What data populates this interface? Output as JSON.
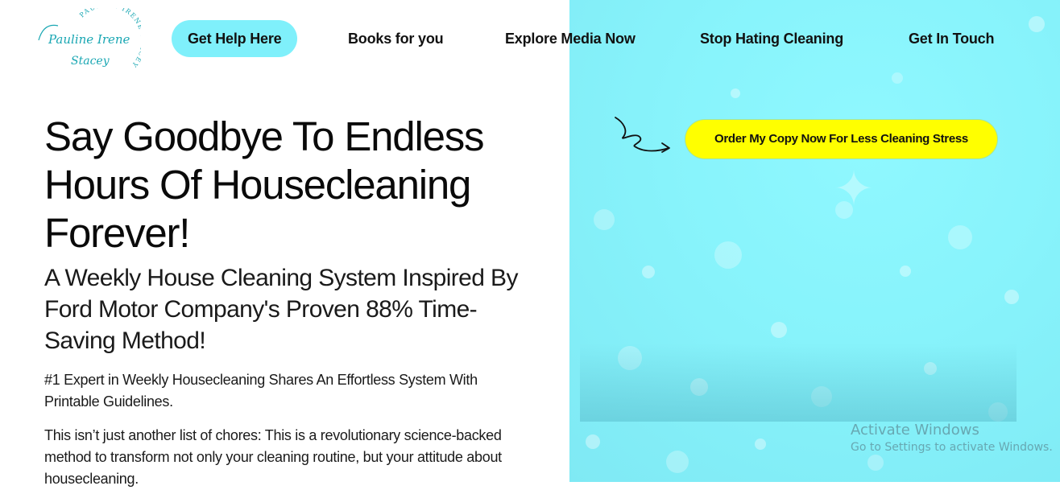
{
  "logo": {
    "arc_text": "PAULINE IRENE STACEY",
    "script_text_line1": "Pauline Irene",
    "script_text_line2": "Stacey"
  },
  "nav": {
    "items": [
      {
        "label": "Get Help Here",
        "active": true
      },
      {
        "label": "Books for you",
        "active": false
      },
      {
        "label": "Explore Media Now",
        "active": false
      },
      {
        "label": "Stop Hating Cleaning",
        "active": false
      },
      {
        "label": "Get In Touch",
        "active": false
      }
    ]
  },
  "hero": {
    "headline": "Say Goodbye To Endless Hours Of Housecleaning Forever!",
    "subhead": "A Weekly House Cleaning System Inspired By Ford Motor Company's Proven 88% Time-Saving Method!",
    "tagline": "#1 Expert in Weekly Housecleaning Shares An Effortless System With Printable Guidelines.",
    "body": "This isn’t just another list of chores: This is a revolutionary science-backed method to transform not only your cleaning routine, but your attitude about housecleaning."
  },
  "cta": {
    "label": "Order My Copy Now For Less Cleaning Stress"
  },
  "watermark": {
    "title": "Activate Windows",
    "subtitle": "Go to Settings to activate Windows."
  },
  "colors": {
    "accent_cyan": "#7ff0fb",
    "cta_yellow": "#ffff00",
    "text": "#0d0d0d",
    "logo_teal": "#1aa7b3"
  },
  "icons": {
    "arrow": "curly-arrow-icon",
    "star": "sparkle-icon"
  }
}
